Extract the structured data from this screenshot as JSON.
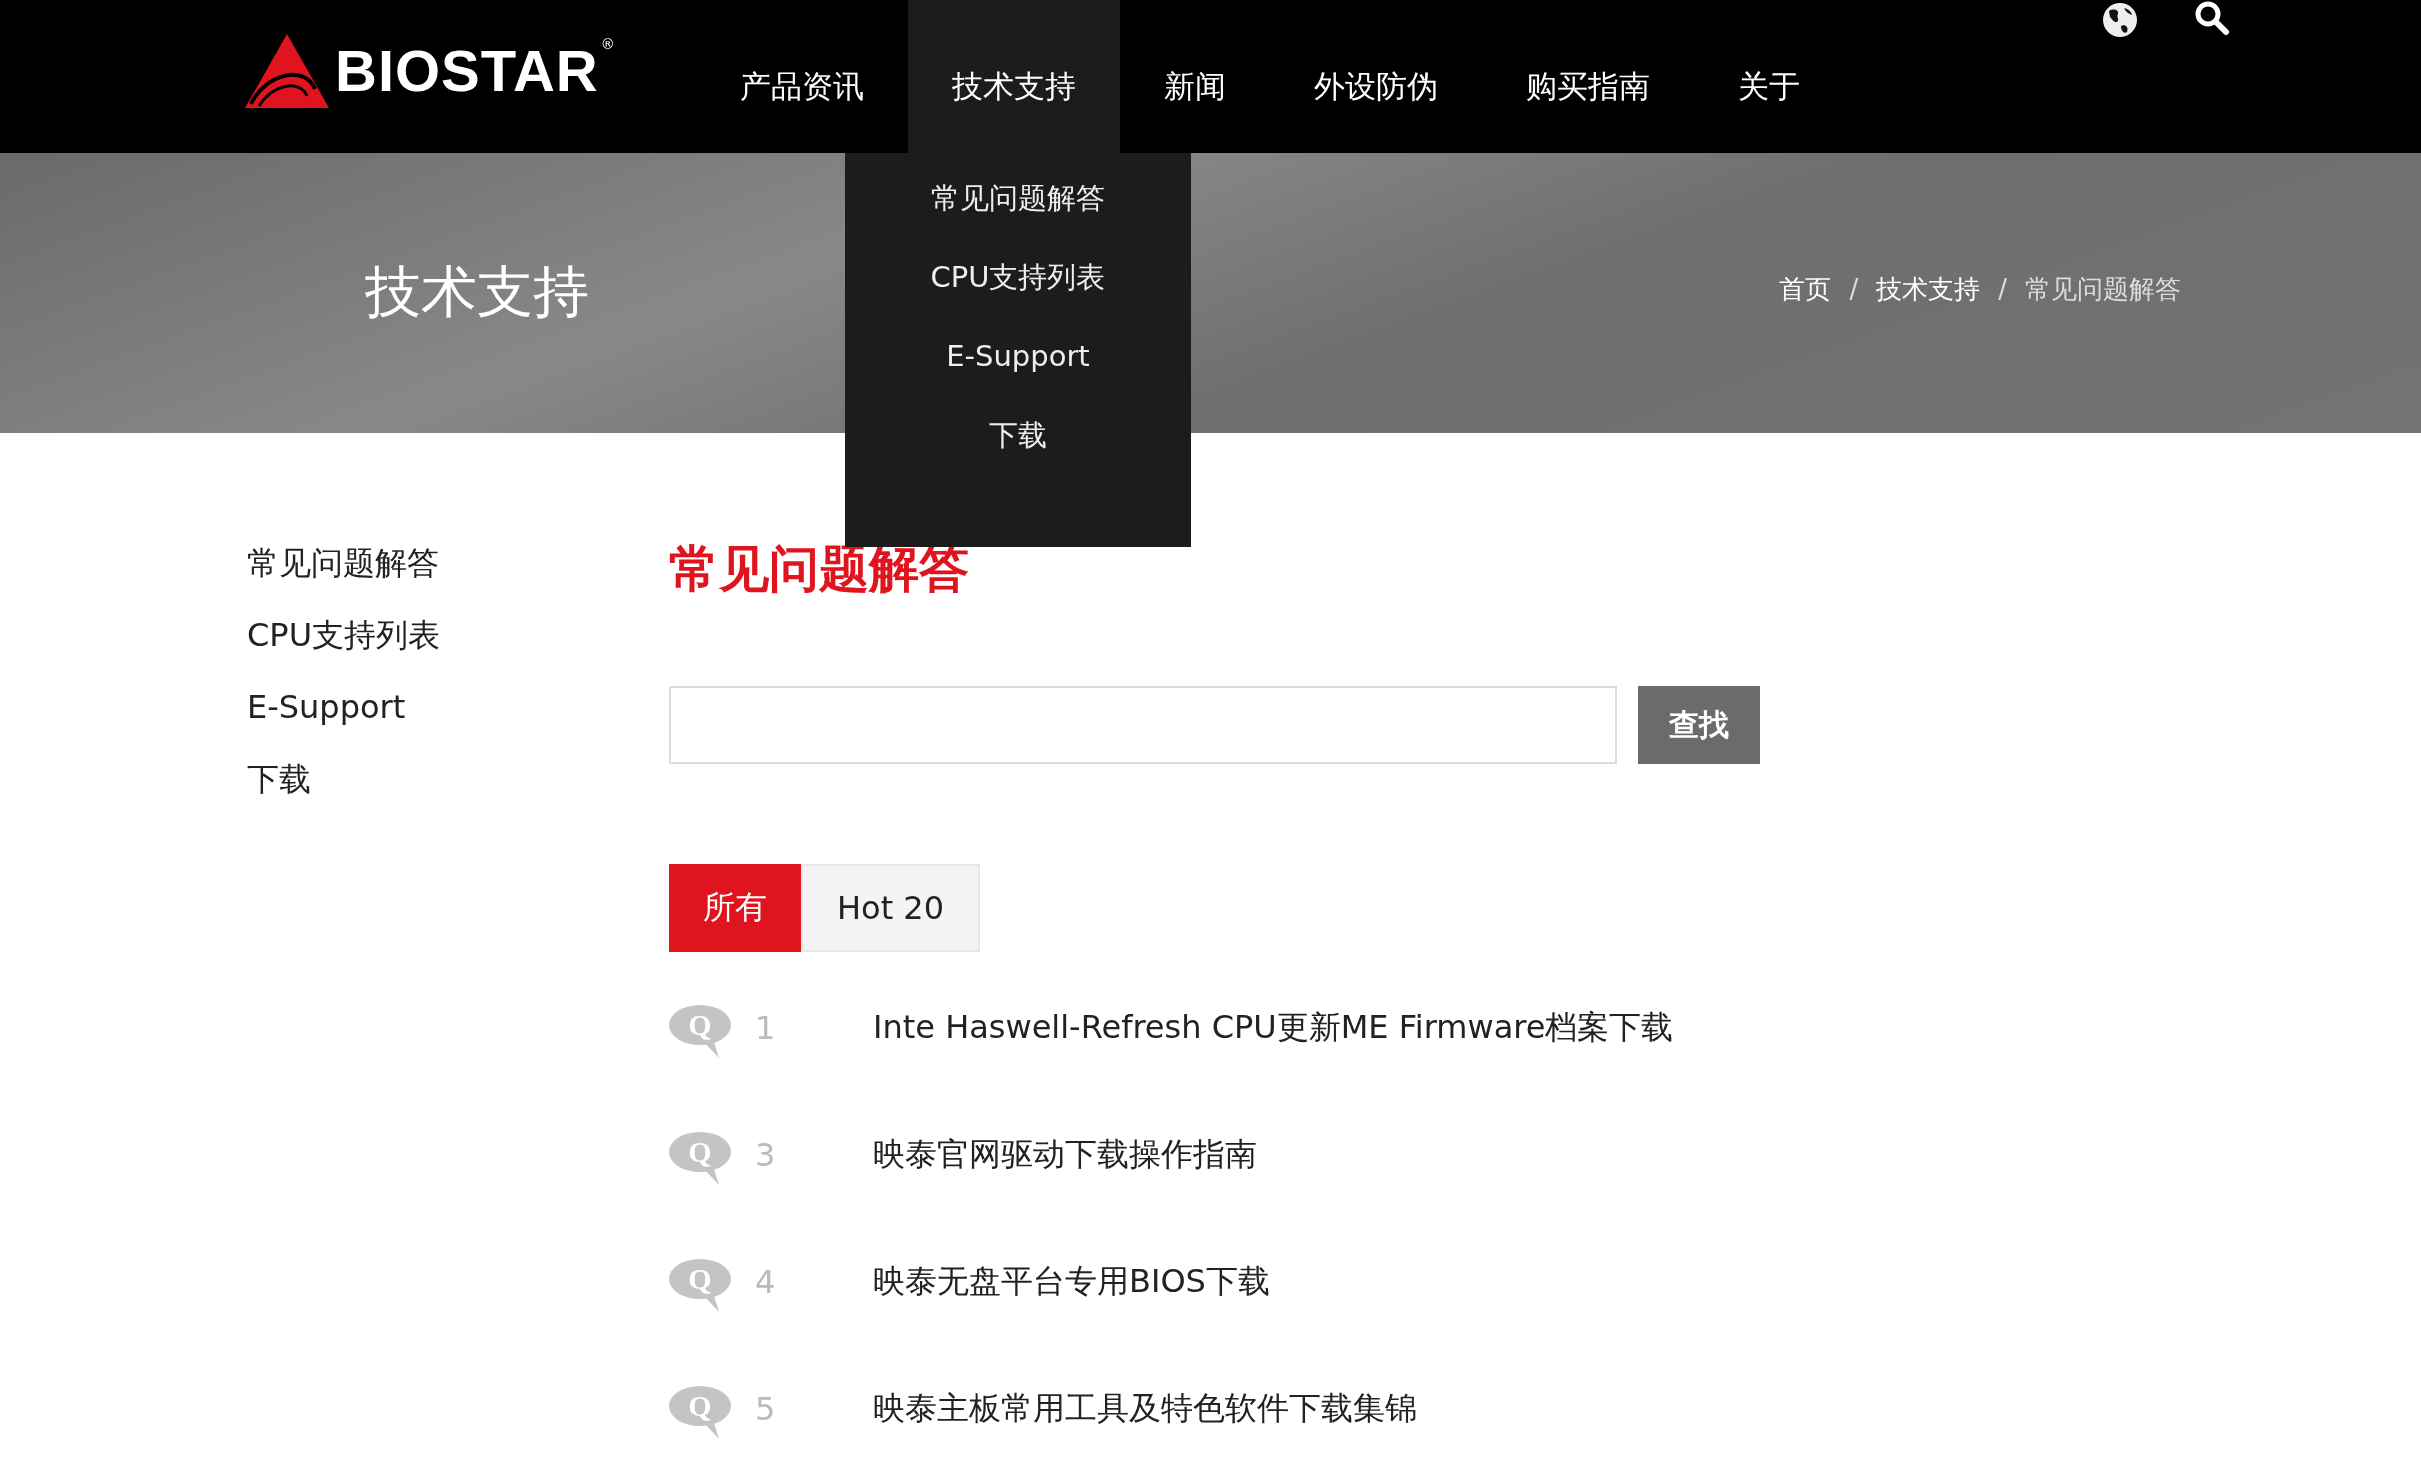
{
  "header": {
    "logo": {
      "name": "BIOSTAR",
      "mark": "®"
    },
    "nav": [
      {
        "label": "产品资讯",
        "selected": false
      },
      {
        "label": "技术支持",
        "selected": true
      },
      {
        "label": "新闻",
        "selected": false
      },
      {
        "label": "外设防伪",
        "selected": false
      },
      {
        "label": "购买指南",
        "selected": false
      },
      {
        "label": "关于",
        "selected": false
      }
    ],
    "dropdown": [
      "常见问题解答",
      "CPU支持列表",
      "E-Support",
      "下载"
    ]
  },
  "banner": {
    "title": "技术支持",
    "breadcrumb": [
      "首页",
      "技术支持",
      "常见问题解答"
    ],
    "separator": "/"
  },
  "sidebar": {
    "items": [
      "常见问题解答",
      "CPU支持列表",
      "E-Support",
      "下载"
    ]
  },
  "main": {
    "heading": "常见问题解答",
    "search": {
      "button": "查找"
    },
    "tabs": [
      {
        "label": "所有",
        "selected": true
      },
      {
        "label": "Hot 20",
        "selected": false
      }
    ],
    "faq": [
      {
        "badge": "Q",
        "number": "1",
        "title": "Inte Haswell-Refresh CPU更新ME Firmware档案下载"
      },
      {
        "badge": "Q",
        "number": "3",
        "title": "映泰官网驱动下载操作指南"
      },
      {
        "badge": "Q",
        "number": "4",
        "title": "映泰无盘平台专用BIOS下载"
      },
      {
        "badge": "Q",
        "number": "5",
        "title": "映泰主板常用工具及特色软件下载集锦"
      }
    ]
  }
}
